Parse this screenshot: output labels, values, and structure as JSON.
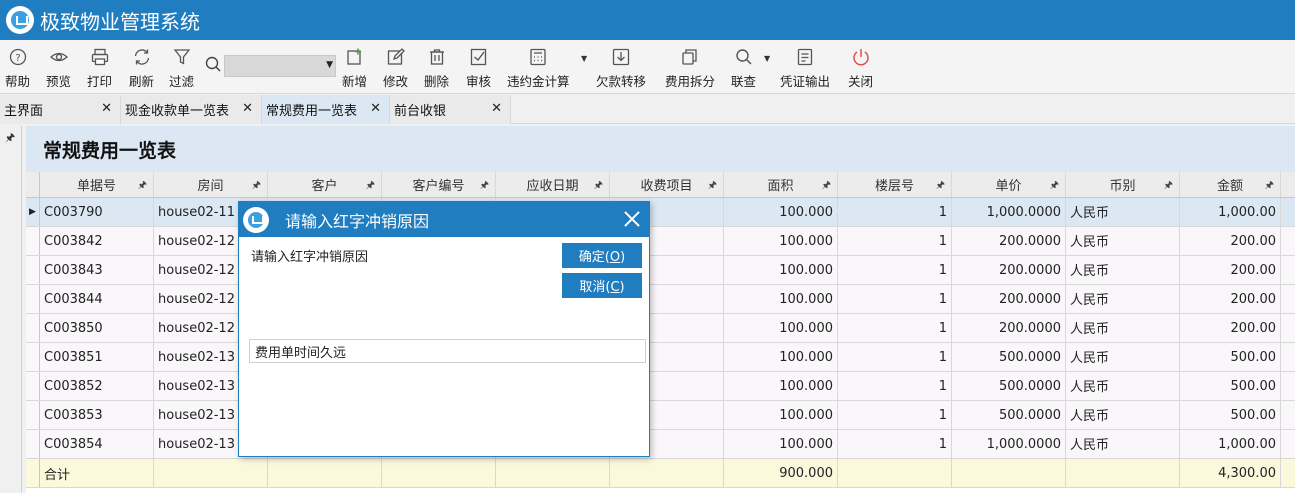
{
  "app": {
    "title": "极致物业管理系统"
  },
  "toolbar": {
    "help": "帮助",
    "preview": "预览",
    "print": "打印",
    "refresh": "刷新",
    "filter": "过滤",
    "search_value": "",
    "add": "新增",
    "edit": "修改",
    "delete": "删除",
    "audit": "审核",
    "penalty": "违约金计算",
    "arrears_transfer": "欠款转移",
    "fee_split": "费用拆分",
    "query": "联查",
    "voucher": "凭证输出",
    "close": "关闭"
  },
  "tabs": [
    {
      "label": "主界面"
    },
    {
      "label": "现金收款单一览表"
    },
    {
      "label": "常规费用一览表"
    },
    {
      "label": "前台收银"
    }
  ],
  "panel": {
    "title": "常规费用一览表"
  },
  "grid": {
    "columns": [
      "单据号",
      "房间",
      "客户",
      "客户编号",
      "应收日期",
      "收费项目",
      "面积",
      "楼层号",
      "单价",
      "币别",
      "金额"
    ],
    "rows": [
      [
        "C003790",
        "house02-11",
        "",
        "",
        "",
        "",
        "100.000",
        "1",
        "1,000.0000",
        "人民币",
        "1,000.00"
      ],
      [
        "C003842",
        "house02-12",
        "",
        "",
        "",
        "",
        "100.000",
        "1",
        "200.0000",
        "人民币",
        "200.00"
      ],
      [
        "C003843",
        "house02-12",
        "",
        "",
        "",
        "",
        "100.000",
        "1",
        "200.0000",
        "人民币",
        "200.00"
      ],
      [
        "C003844",
        "house02-12",
        "",
        "",
        "",
        "",
        "100.000",
        "1",
        "200.0000",
        "人民币",
        "200.00"
      ],
      [
        "C003850",
        "house02-12",
        "",
        "",
        "",
        "",
        "100.000",
        "1",
        "200.0000",
        "人民币",
        "200.00"
      ],
      [
        "C003851",
        "house02-13",
        "",
        "",
        "",
        "",
        "100.000",
        "1",
        "500.0000",
        "人民币",
        "500.00"
      ],
      [
        "C003852",
        "house02-13",
        "",
        "",
        "",
        "",
        "100.000",
        "1",
        "500.0000",
        "人民币",
        "500.00"
      ],
      [
        "C003853",
        "house02-13",
        "",
        "",
        "",
        "",
        "100.000",
        "1",
        "500.0000",
        "人民币",
        "500.00"
      ],
      [
        "C003854",
        "house02-13",
        "",
        "",
        "",
        "",
        "100.000",
        "1",
        "1,000.0000",
        "人民币",
        "1,000.00"
      ]
    ],
    "total": {
      "label": "合计",
      "area": "900.000",
      "amount": "4,300.00"
    }
  },
  "dialog": {
    "title": "请输入红字冲销原因",
    "prompt": "请输入红字冲销原因",
    "ok_text": "确定(",
    "ok_key": "O",
    "cancel_text": "取消(",
    "cancel_key": "C",
    "paren_close": ")",
    "input_value": "费用单时间久远"
  }
}
